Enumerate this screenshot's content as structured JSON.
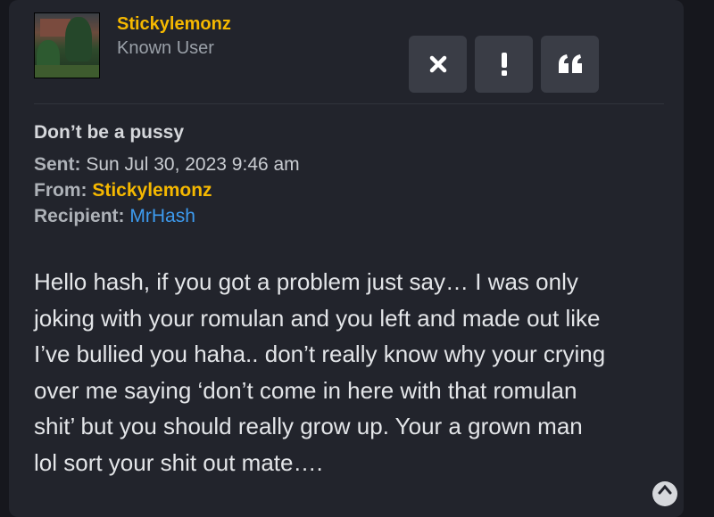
{
  "author": {
    "name": "Stickylemonz",
    "rank": "Known User"
  },
  "actions": {
    "delete_icon": "close-icon",
    "report_icon": "exclamation-icon",
    "quote_icon": "quote-icon"
  },
  "message": {
    "subject": "Don’t be a pussy",
    "sent_label": "Sent:",
    "sent_value": "Sun Jul 30, 2023 9:46 am",
    "from_label": "From:",
    "from_value": "Stickylemonz",
    "recipient_label": "Recipient:",
    "recipient_value": "MrHash",
    "body_lines": [
      "Hello hash, if you got a problem just say… I was only",
      "joking with your romulan and you left and made out like",
      "I’ve bullied you haha.. don’t really know why your crying",
      "over me saying ‘don’t come in here with that romulan",
      "shit’ but you should really grow up. Your a grown man",
      "lol sort your shit out mate…."
    ]
  },
  "colors": {
    "username": "#f5b800",
    "link": "#3d9bef",
    "panel": "#22242c",
    "background": "#16171d"
  }
}
